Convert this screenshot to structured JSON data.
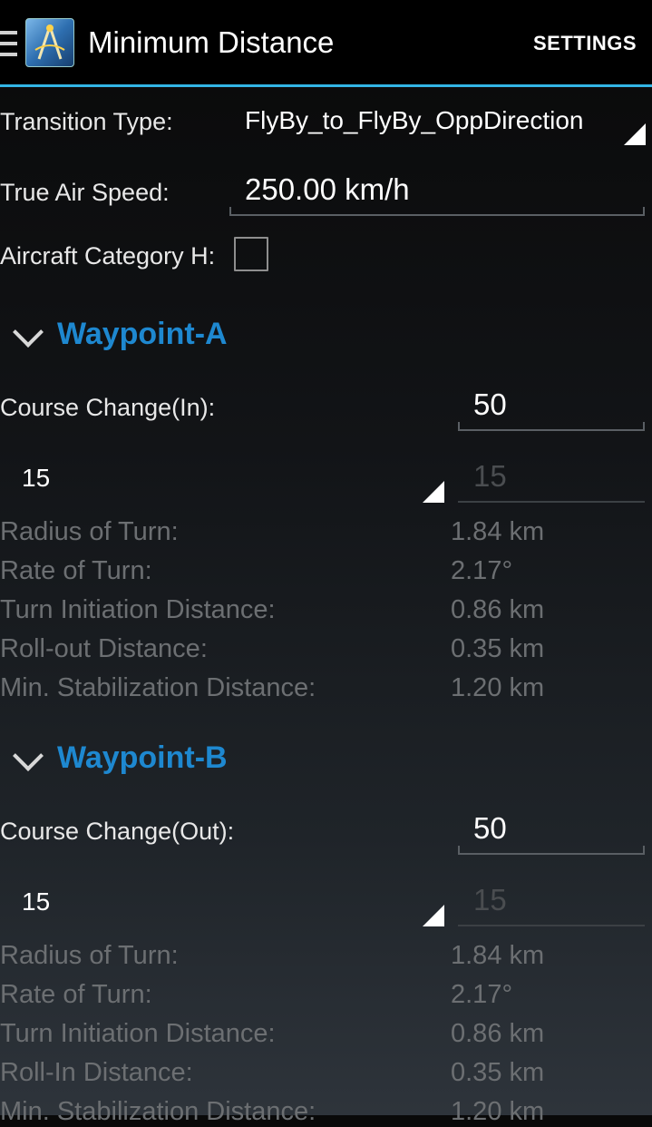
{
  "header": {
    "title": "Minimum Distance",
    "settings_label": "SETTINGS",
    "menu_icon": "hamburger-icon",
    "app_icon": "app-compass-icon"
  },
  "form": {
    "transition_type_label": "Transition Type:",
    "transition_type_value": "FlyBy_to_FlyBy_OppDirection",
    "true_air_speed_label": "True Air Speed:",
    "true_air_speed_value": "250.00 km/h",
    "aircraft_category_label": "Aircraft Category H:",
    "aircraft_category_checked": false
  },
  "waypoint_a": {
    "title": "Waypoint-A",
    "course_change_label": "Course Change(In):",
    "course_change_value": "50",
    "bank_spinner_value": "15",
    "bank_field_value": "15",
    "rows": [
      {
        "label": "Radius of Turn:",
        "value": "1.84 km"
      },
      {
        "label": "Rate of Turn:",
        "value": "2.17°"
      },
      {
        "label": "Turn Initiation Distance:",
        "value": "0.86 km"
      },
      {
        "label": "Roll-out Distance:",
        "value": "0.35 km"
      },
      {
        "label": "Min. Stabilization Distance:",
        "value": "1.20 km"
      }
    ]
  },
  "waypoint_b": {
    "title": "Waypoint-B",
    "course_change_label": "Course Change(Out):",
    "course_change_value": "50",
    "bank_spinner_value": "15",
    "bank_field_value": "15",
    "rows": [
      {
        "label": "Radius of Turn:",
        "value": "1.84 km"
      },
      {
        "label": "Rate of Turn:",
        "value": "2.17°"
      },
      {
        "label": "Turn Initiation Distance:",
        "value": "0.86 km"
      },
      {
        "label": "Roll-In Distance:",
        "value": "0.35 km"
      },
      {
        "label": "Min. Stabilization Distance:",
        "value": "1.20 km"
      }
    ]
  },
  "colors": {
    "accent": "#33b5e5",
    "section_title": "#1e88d0",
    "muted_text": "#6c6f72"
  }
}
